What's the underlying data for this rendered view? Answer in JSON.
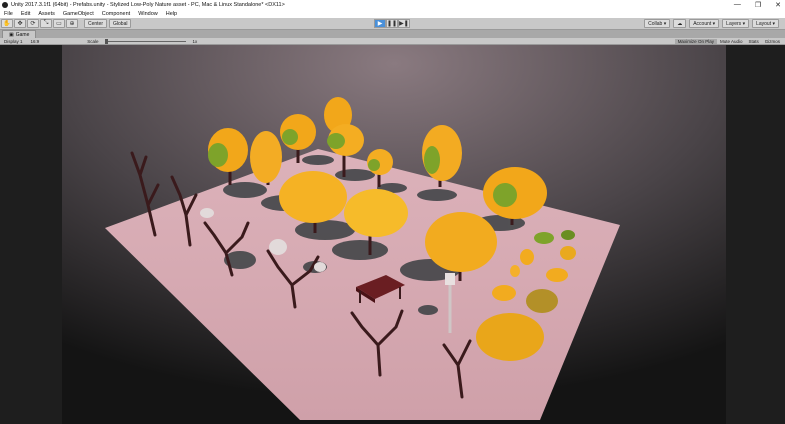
{
  "window": {
    "title": "Unity 2017.3.1f1 (64bit) - Prefabs.unity - Stylized Low-Poly Nature asset - PC, Mac & Linux Standalone* <DX11>",
    "controls": [
      "—",
      "❐",
      "✕"
    ]
  },
  "menu": [
    "File",
    "Edit",
    "Assets",
    "GameObject",
    "Component",
    "Window",
    "Help"
  ],
  "toolbar": {
    "tools": [
      "✋",
      "✥",
      "⟳",
      "⤡",
      "▭",
      "⊕"
    ],
    "pivot": "Center",
    "space": "Global",
    "collab": "Collab ▾",
    "account": "Account ▾",
    "layers": "Layers ▾",
    "layout": "Layout ▾",
    "cloud_icon": "cloud-icon"
  },
  "play_controls": [
    "▶",
    "❚❚",
    "▶❚"
  ],
  "tabs": {
    "game": "Game"
  },
  "game_bar": {
    "display": "Display 1",
    "aspect": "16:9",
    "scale_label": "Scale",
    "scale_value": "1x",
    "maximize": "Maximize On Play",
    "mute": "Mute Audio",
    "stats": "Stats",
    "gizmos": "Gizmos"
  },
  "colors": {
    "ground": "#d8a9b1",
    "foliage_orange": "#f4a81c",
    "foliage_yellow": "#f6bb2a",
    "foliage_green": "#7ea32a",
    "trunk": "#3a1a1c",
    "shadow": "#2f3436"
  }
}
